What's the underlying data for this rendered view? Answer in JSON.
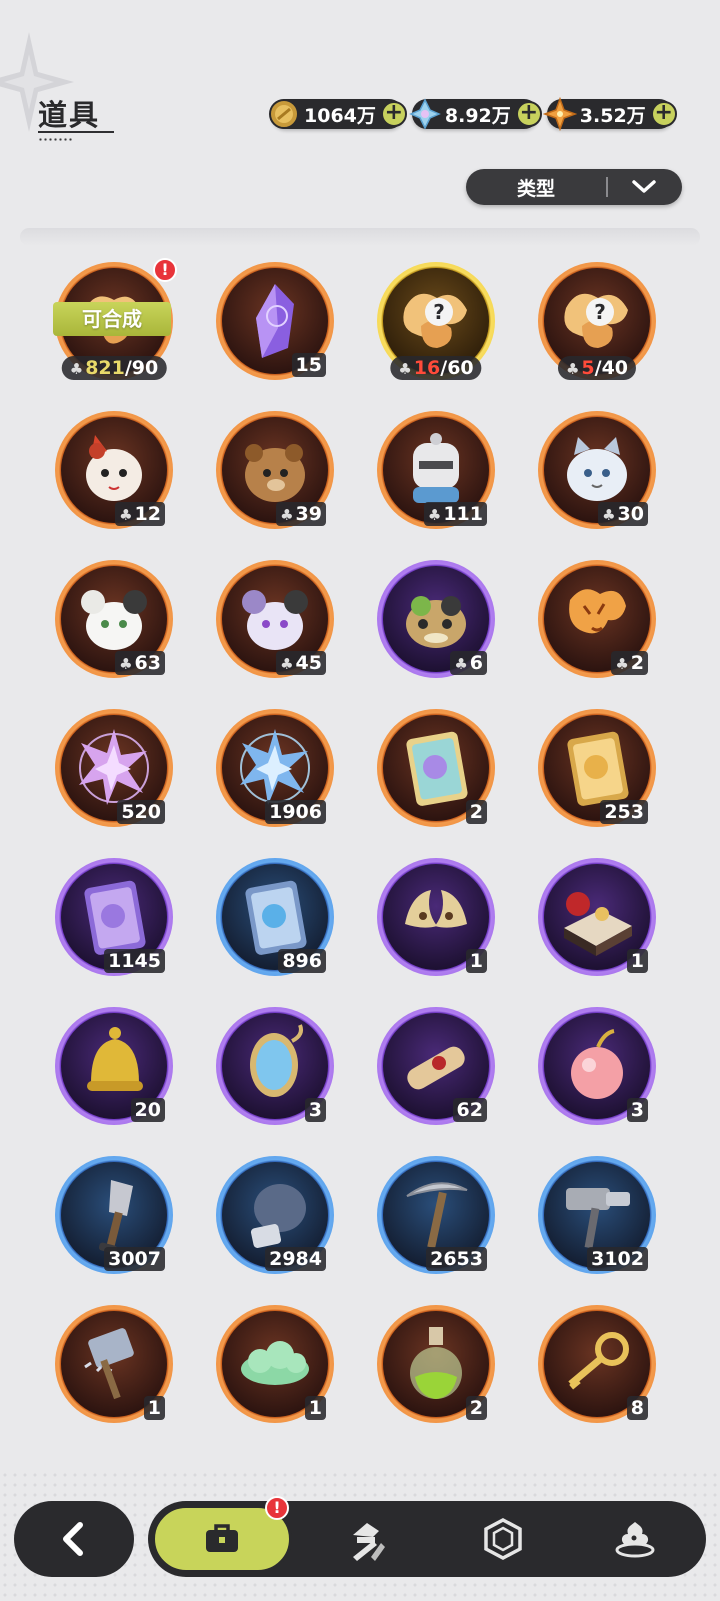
{
  "header": {
    "title": "道具",
    "currencies": [
      {
        "name": "gold-coin-icon",
        "amount": "1064万"
      },
      {
        "name": "crystal-icon",
        "amount": "8.92万"
      },
      {
        "name": "star-gem-icon",
        "amount": "3.52万"
      }
    ],
    "plus_label": "+"
  },
  "filter": {
    "label": "类型"
  },
  "items": [
    {
      "name": "mystery-puzzle-piece",
      "rarity": "orange",
      "synth_label": "可合成",
      "have": "821",
      "need": "/90",
      "alert": "!",
      "icon": "puzzle-pieces-icon"
    },
    {
      "name": "purple-crystal",
      "rarity": "orange",
      "count": "15",
      "icon": "purple-crystal-icon"
    },
    {
      "name": "mystery-puzzle-gold",
      "rarity": "gold",
      "have": "16",
      "need": "/60",
      "icon": "mystery-puzzle-icon"
    },
    {
      "name": "mystery-puzzle-orange",
      "rarity": "orange",
      "have": "5",
      "need": "/40",
      "icon": "mystery-puzzle-icon"
    },
    {
      "name": "fox-mask-fragment",
      "rarity": "orange",
      "count": "12",
      "icon": "fox-creature-icon"
    },
    {
      "name": "bear-fragment",
      "rarity": "orange",
      "count": "39",
      "icon": "bear-creature-icon"
    },
    {
      "name": "knight-fragment",
      "rarity": "orange",
      "count": "111",
      "icon": "knight-creature-icon"
    },
    {
      "name": "cat-fragment",
      "rarity": "orange",
      "count": "30",
      "icon": "cat-creature-icon"
    },
    {
      "name": "white-mouse-fragment",
      "rarity": "orange",
      "count": "63",
      "icon": "mouse-creature-icon"
    },
    {
      "name": "purple-mouse-fragment",
      "rarity": "orange",
      "count": "45",
      "icon": "purple-mouse-creature-icon"
    },
    {
      "name": "frog-fragment",
      "rarity": "purple",
      "count": "6",
      "icon": "frog-creature-icon"
    },
    {
      "name": "tiger-fragment",
      "rarity": "orange",
      "count": "2",
      "icon": "tiger-creature-icon"
    },
    {
      "name": "pink-star-crystal",
      "rarity": "orange",
      "count": "520",
      "icon": "pink-star-crystal-icon"
    },
    {
      "name": "blue-star-crystal",
      "rarity": "orange",
      "count": "1906",
      "icon": "blue-star-crystal-icon"
    },
    {
      "name": "rainbow-card",
      "rarity": "orange",
      "count": "2",
      "icon": "rainbow-card-icon"
    },
    {
      "name": "gold-card",
      "rarity": "orange",
      "count": "253",
      "icon": "gold-card-icon"
    },
    {
      "name": "purple-card",
      "rarity": "purple",
      "count": "1145",
      "icon": "purple-card-icon"
    },
    {
      "name": "blue-card",
      "rarity": "blue",
      "count": "896",
      "icon": "blue-card-icon"
    },
    {
      "name": "gold-horns",
      "rarity": "purple",
      "count": "1",
      "icon": "horns-icon"
    },
    {
      "name": "gift-box",
      "rarity": "purple",
      "count": "1",
      "icon": "gift-box-icon"
    },
    {
      "name": "gold-bell",
      "rarity": "purple",
      "count": "20",
      "icon": "bell-icon"
    },
    {
      "name": "magic-mirror",
      "rarity": "purple",
      "count": "3",
      "icon": "mirror-icon"
    },
    {
      "name": "scroll",
      "rarity": "purple",
      "count": "62",
      "icon": "scroll-icon"
    },
    {
      "name": "pink-apple",
      "rarity": "purple",
      "count": "3",
      "icon": "apple-icon"
    },
    {
      "name": "shovel",
      "rarity": "blue",
      "count": "3007",
      "icon": "shovel-icon"
    },
    {
      "name": "boxing-glove",
      "rarity": "blue",
      "count": "2984",
      "icon": "glove-icon"
    },
    {
      "name": "pickaxe",
      "rarity": "blue",
      "count": "2653",
      "icon": "pickaxe-icon"
    },
    {
      "name": "hammer",
      "rarity": "blue",
      "count": "3102",
      "icon": "hammer-icon"
    },
    {
      "name": "spiked-mallet",
      "rarity": "orange",
      "count": "1",
      "icon": "mallet-icon"
    },
    {
      "name": "green-cloud",
      "rarity": "orange",
      "count": "1",
      "icon": "cloud-icon"
    },
    {
      "name": "potion-bottle",
      "rarity": "orange",
      "count": "2",
      "icon": "potion-icon"
    },
    {
      "name": "gold-key",
      "rarity": "orange",
      "count": "8",
      "icon": "key-icon"
    }
  ],
  "navbar": {
    "back_icon": "back-arrow-icon",
    "tabs": [
      {
        "name": "bag",
        "icon": "briefcase-icon",
        "active": true,
        "alert": "!"
      },
      {
        "name": "equipment",
        "icon": "hat-tools-icon",
        "active": false
      },
      {
        "name": "gems",
        "icon": "hexagon-gem-icon",
        "active": false
      },
      {
        "name": "food",
        "icon": "dessert-icon",
        "active": false
      }
    ]
  },
  "colors": {
    "accent": "#c8d45a",
    "dark": "#2a2a2d",
    "orange_rarity": "#f08c3e",
    "purple_rarity": "#a874f2",
    "blue_rarity": "#5ba0ee",
    "gold_rarity": "#f4d44a",
    "alert_red": "#e8343a"
  }
}
